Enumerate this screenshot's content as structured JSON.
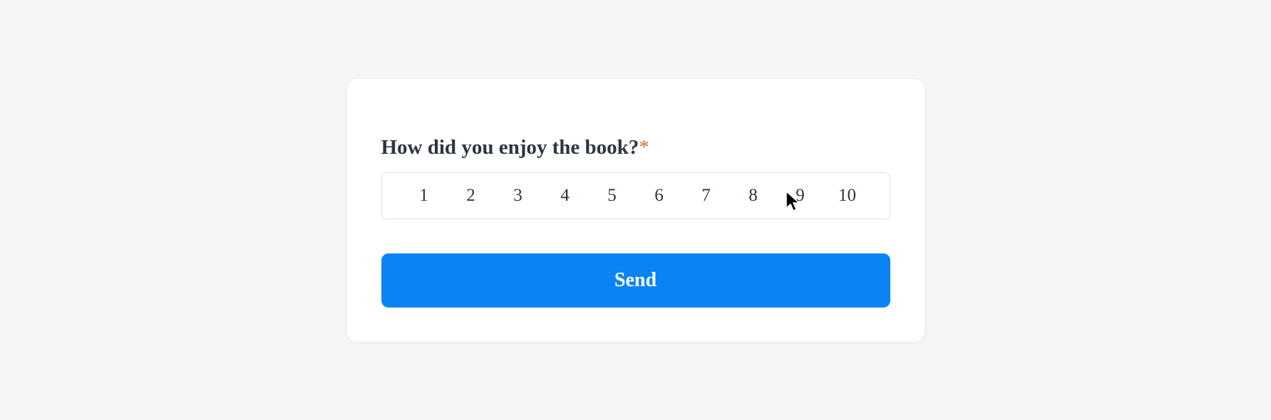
{
  "question": {
    "label": "How did you enjoy the book?",
    "required_mark": "*"
  },
  "rating": {
    "options": [
      "1",
      "2",
      "3",
      "4",
      "5",
      "6",
      "7",
      "8",
      "9",
      "10"
    ]
  },
  "submit": {
    "label": "Send"
  }
}
